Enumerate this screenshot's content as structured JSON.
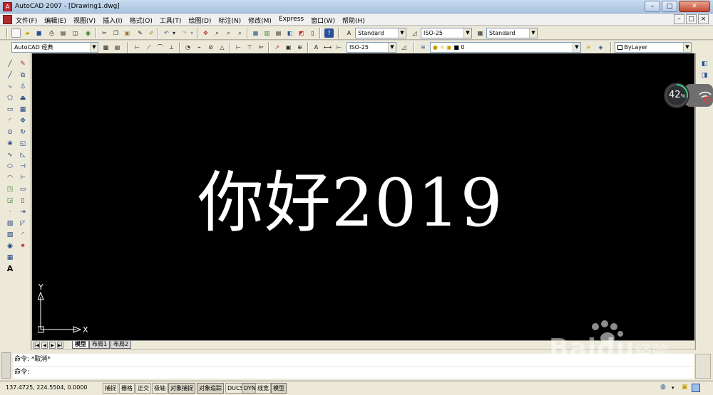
{
  "window": {
    "title": "AutoCAD 2007 - [Drawing1.dwg]",
    "app_icon": "autocad-icon"
  },
  "menubar": {
    "items": [
      "文件(F)",
      "编辑(E)",
      "视图(V)",
      "插入(I)",
      "格式(O)",
      "工具(T)",
      "绘图(D)",
      "标注(N)",
      "修改(M)",
      "Express",
      "窗口(W)",
      "帮助(H)"
    ]
  },
  "toolbar2": {
    "text_style": "Standard",
    "dim_style": "ISO-25",
    "table_style": "Standard"
  },
  "toolbar3": {
    "workspace": "AutoCAD 经典",
    "dim_style2": "ISO-25",
    "layer": "0",
    "color": "ByLayer"
  },
  "left_toolbar": {
    "text_tool": "A"
  },
  "canvas": {
    "drawing_text": "你好2019",
    "background": "#000000",
    "ucs_x_label": "X",
    "ucs_y_label": "Y"
  },
  "layout_tabs": [
    "模型",
    "布局1",
    "布局2"
  ],
  "command": {
    "line1": "命令: *取消*",
    "line2": "命令:"
  },
  "status": {
    "coords": "137.4725, 224.5504, 0.0000",
    "buttons": [
      "捕捉",
      "栅格",
      "正交",
      "极轴",
      "对象捕捉",
      "对象追踪",
      "DUCS",
      "DYN",
      "线宽",
      "模型"
    ]
  },
  "overlay": {
    "network_percent": "42",
    "percent_unit": "%"
  },
  "watermark": {
    "brand": "Baidu",
    "brand_cn": "经验",
    "url": "jingyan.baidu.com"
  }
}
